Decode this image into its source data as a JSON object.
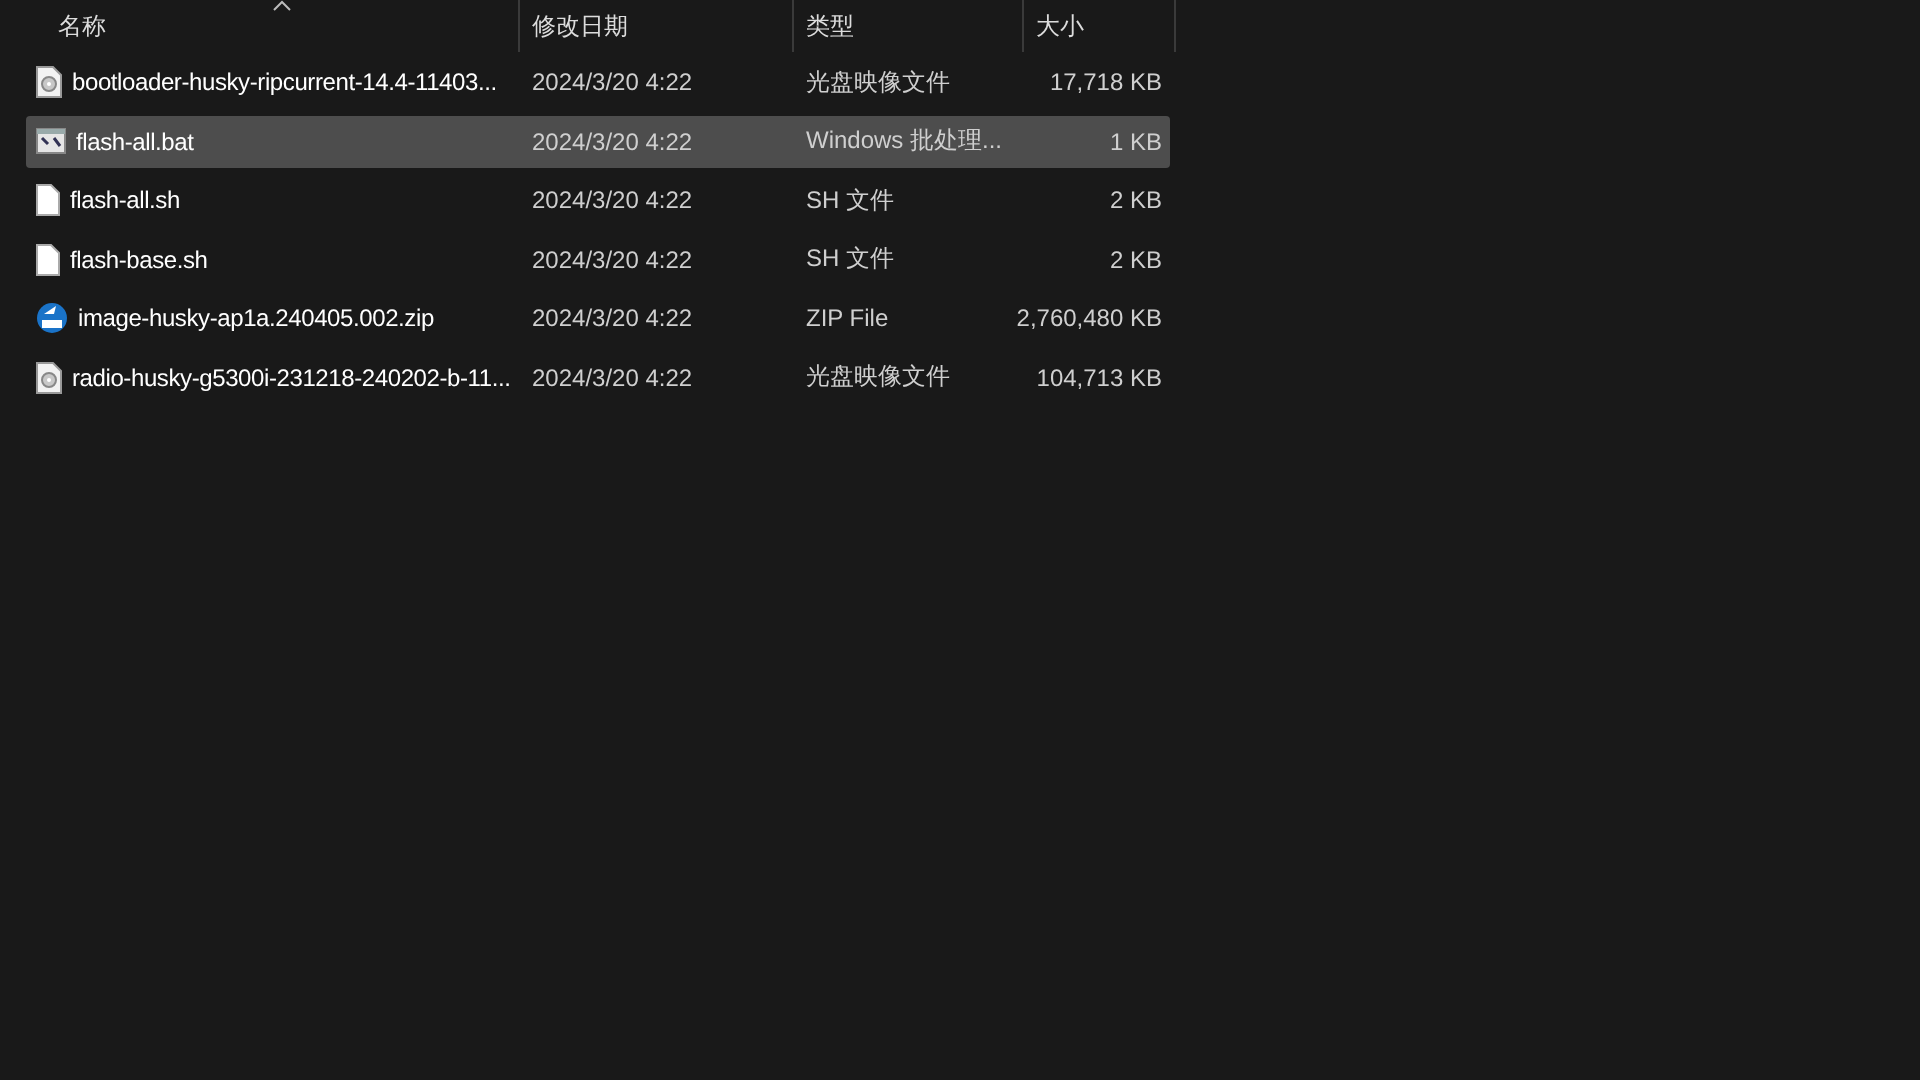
{
  "columns": [
    {
      "label": "名称",
      "sorted": true
    },
    {
      "label": "修改日期",
      "sorted": false
    },
    {
      "label": "类型",
      "sorted": false
    },
    {
      "label": "大小",
      "sorted": false
    }
  ],
  "rows": [
    {
      "kind": "disc",
      "name": "bootloader-husky-ripcurrent-14.4-11403...",
      "date": "2024/3/20 4:22",
      "type": "光盘映像文件",
      "size": "17,718 KB",
      "selected": false
    },
    {
      "kind": "batch",
      "name": "flash-all.bat",
      "date": "2024/3/20 4:22",
      "type": "Windows 批处理...",
      "size": "1 KB",
      "selected": true
    },
    {
      "kind": "file",
      "name": "flash-all.sh",
      "date": "2024/3/20 4:22",
      "type": "SH 文件",
      "size": "2 KB",
      "selected": false
    },
    {
      "kind": "file",
      "name": "flash-base.sh",
      "date": "2024/3/20 4:22",
      "type": "SH 文件",
      "size": "2 KB",
      "selected": false
    },
    {
      "kind": "zip",
      "name": "image-husky-ap1a.240405.002.zip",
      "date": "2024/3/20 4:22",
      "type": "ZIP File",
      "size": "2,760,480 KB",
      "selected": false
    },
    {
      "kind": "disc",
      "name": "radio-husky-g5300i-231218-240202-b-11...",
      "date": "2024/3/20 4:22",
      "type": "光盘映像文件",
      "size": "104,713 KB",
      "selected": false
    }
  ]
}
